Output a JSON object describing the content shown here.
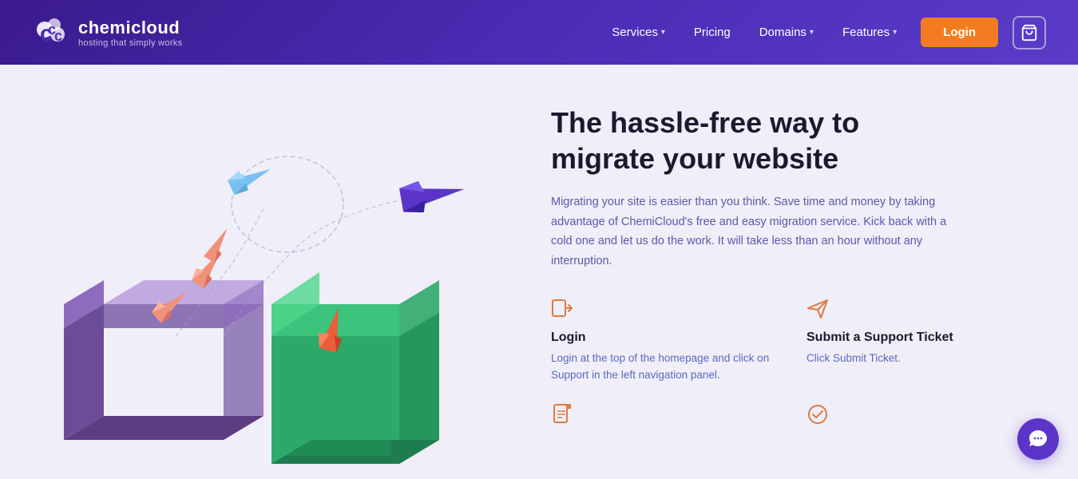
{
  "header": {
    "logo_name": "chemicloud",
    "logo_tagline": "hosting that simply works",
    "nav_items": [
      {
        "label": "Services",
        "has_dropdown": true
      },
      {
        "label": "Pricing",
        "has_dropdown": false
      },
      {
        "label": "Domains",
        "has_dropdown": true
      },
      {
        "label": "Features",
        "has_dropdown": true
      }
    ],
    "login_label": "Login",
    "cart_label": "Cart"
  },
  "main": {
    "title": "The hassle-free way to migrate your website",
    "description": "Migrating your site is easier than you think. Save time and money by taking advantage of ChemiCloud's free and easy migration service. Kick back with a cold one and let us do the work. It will take less than an hour without any interruption.",
    "features": [
      {
        "id": "login",
        "title": "Login",
        "desc": "Login at the top of the homepage and click on Support in the left navigation panel.",
        "icon": "login-icon"
      },
      {
        "id": "support-ticket",
        "title": "Submit a Support Ticket",
        "desc": "Click Submit Ticket.",
        "icon": "send-icon"
      },
      {
        "id": "details",
        "title": "",
        "desc": "",
        "icon": "file-icon"
      },
      {
        "id": "verify",
        "title": "",
        "desc": "",
        "icon": "check-icon"
      }
    ]
  },
  "chat": {
    "label": "Chat"
  },
  "colors": {
    "brand_purple": "#4b2cb5",
    "accent_orange": "#f47c20",
    "text_dark": "#1a1a2e",
    "text_blue": "#5a5aaa",
    "feature_orange": "#e07a40"
  }
}
